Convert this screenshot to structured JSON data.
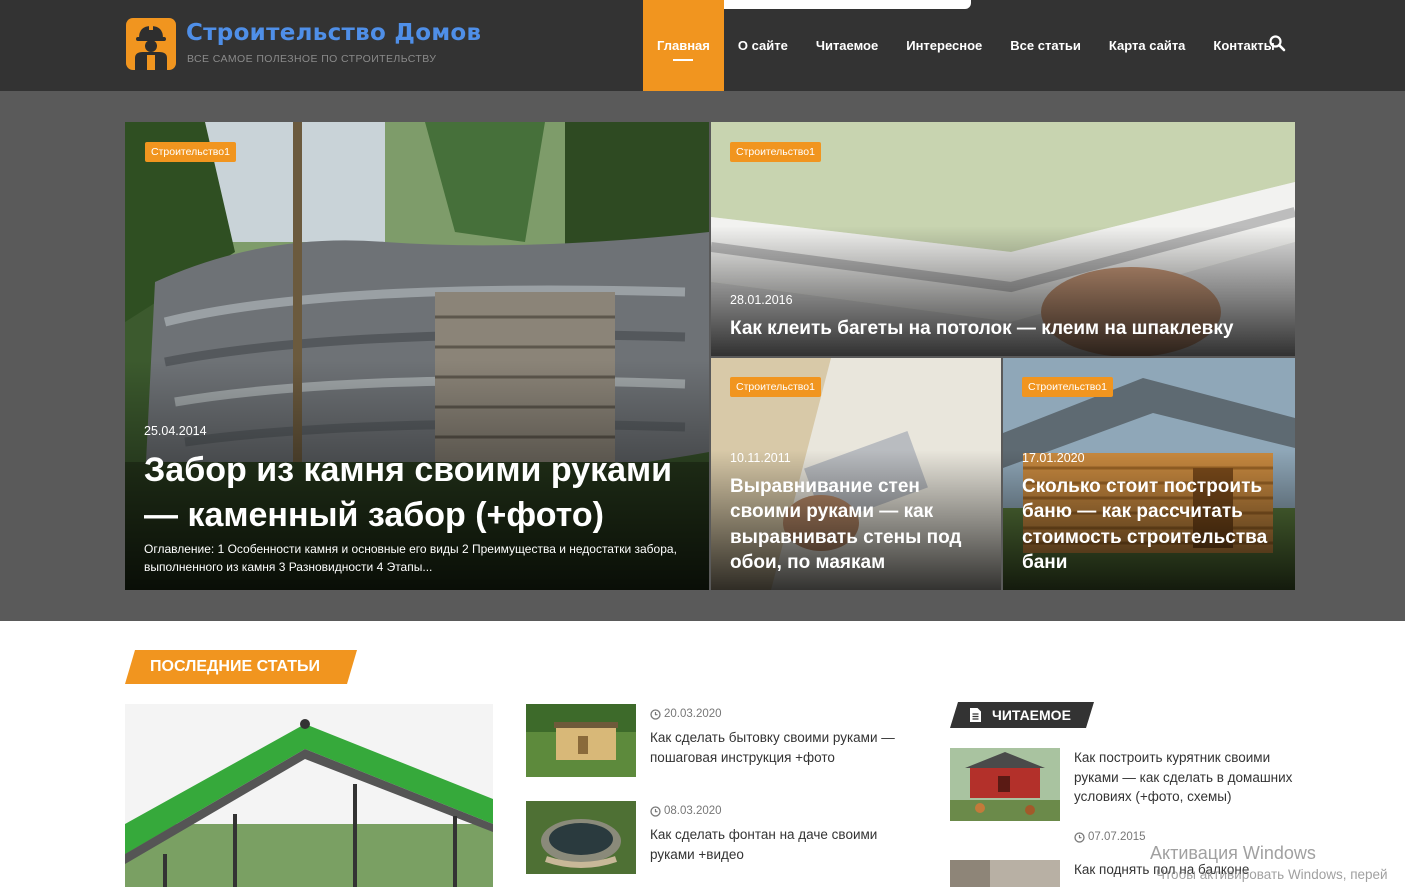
{
  "site": {
    "title": "Строительство Домов",
    "tagline": "ВСЕ САМОЕ ПОЛЕЗНОЕ ПО СТРОИТЕЛЬСТВУ",
    "accent_color": "#f1951f",
    "header_color": "#333333",
    "logo_color": "#4f8fe8"
  },
  "nav": {
    "items": [
      "Главная",
      "О сайте",
      "Читаемое",
      "Интересное",
      "Все статьи",
      "Карта сайта",
      "Контакты"
    ],
    "active": "Главная",
    "search_icon": "search-icon"
  },
  "featured": [
    {
      "category": "Строительство1",
      "date": "25.04.2014",
      "title": "Забор из камня своими руками — каменный забор (+фото)",
      "excerpt": "Оглавление: 1 Особенности камня и основные его виды 2 Преимущества и недостатки забора, выполненного из камня 3 Разновидности 4 Этапы..."
    },
    {
      "category": "Строительство1",
      "date": "28.01.2016",
      "title": "Как клеить багеты на потолок — клеим на шпаклевку"
    },
    {
      "category": "Строительство1",
      "date": "10.11.2011",
      "title": "Выравнивание стен своими руками — как выравнивать стены под обои, по маякам"
    },
    {
      "category": "Строительство1",
      "date": "17.01.2020",
      "title": "Сколько стоит построить баню — как рассчитать стоимость строительства бани"
    }
  ],
  "latest": {
    "heading": "ПОСЛЕДНИЕ СТАТЬИ",
    "posts": [
      {
        "date": "20.03.2020",
        "title": "Как сделать бытовку своими руками — пошаговая инструкция +фото"
      },
      {
        "date": "08.03.2020",
        "title": "Как сделать фонтан на даче своими руками +видео"
      }
    ]
  },
  "sidebar": {
    "heading": "ЧИТАЕМОЕ",
    "posts": [
      {
        "date": "07.07.2015",
        "title": "Как построить курятник своими руками — как сделать в домашних условиях (+фото, схемы)"
      },
      {
        "title": "Как поднять пол на балконе"
      }
    ]
  },
  "watermark": {
    "line1": "Активация Windows",
    "line2": "Чтобы активировать Windows, перей"
  }
}
